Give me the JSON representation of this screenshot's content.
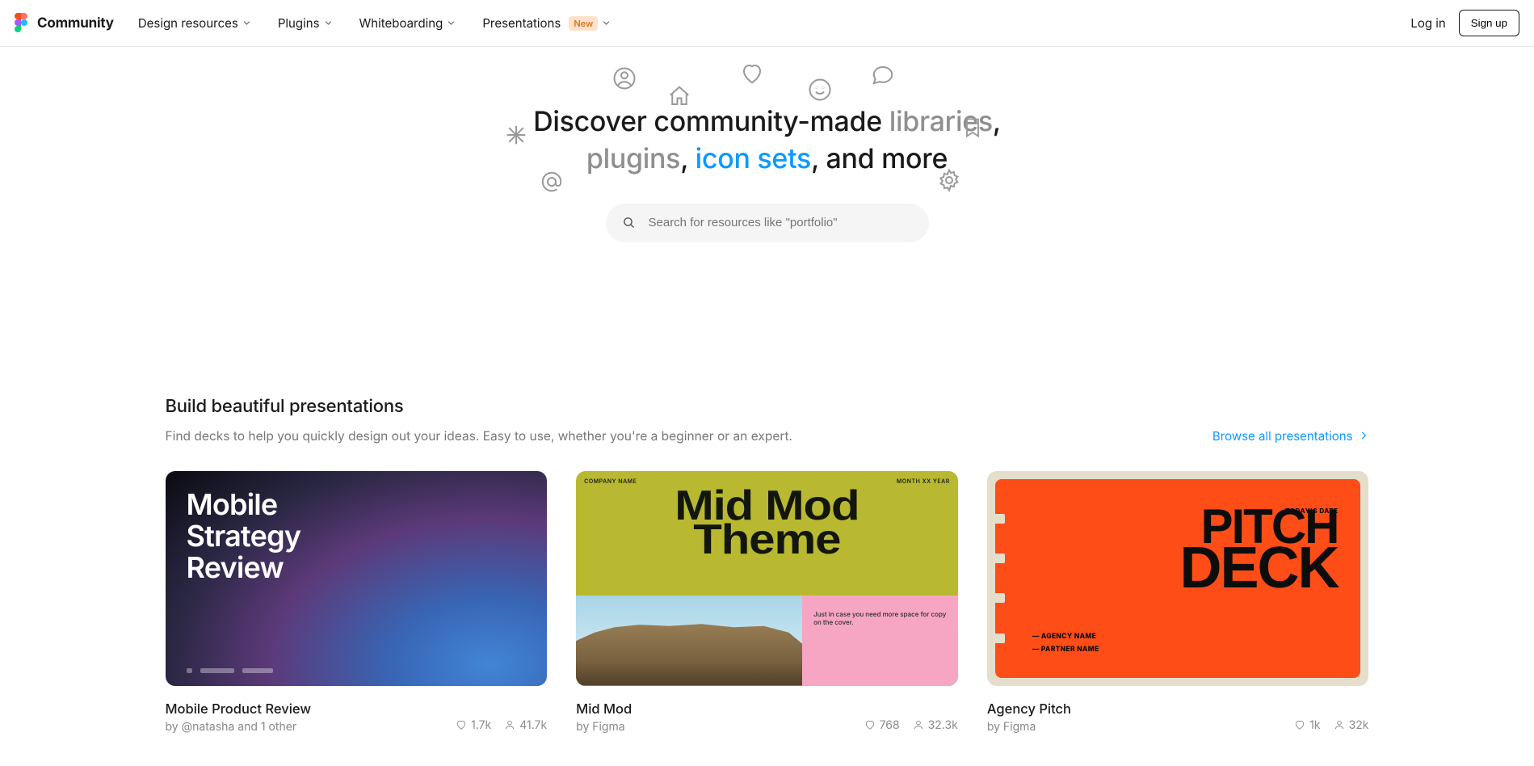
{
  "header": {
    "logo_text": "Community",
    "nav": {
      "design_resources": "Design resources",
      "plugins": "Plugins",
      "whiteboarding": "Whiteboarding",
      "presentations": "Presentations",
      "presentations_badge": "New"
    },
    "auth": {
      "login": "Log in",
      "signup": "Sign up"
    }
  },
  "hero": {
    "prefix": "Discover community-made ",
    "word1": "libraries",
    "sep1": ", ",
    "word2": "plugins",
    "sep2": ", ",
    "highlight": "icon sets",
    "suffix": ", and more",
    "search_placeholder": "Search for resources like \"portfolio\""
  },
  "section": {
    "title": "Build beautiful presentations",
    "subtitle": "Find decks to help you quickly design out your ideas. Easy to use, whether you're a beginner or an expert.",
    "browse": "Browse all presentations"
  },
  "cards": [
    {
      "thumb_text": "Mobile\nStrategy\nReview",
      "title": "Mobile Product Review",
      "author": "by @natasha and 1 other",
      "likes": "1.7k",
      "users": "41.7k"
    },
    {
      "thumb_text": "Mid Mod\nTheme",
      "thumb_meta": {
        "left": "COMPANY NAME",
        "right": "MONTH XX YEAR",
        "aside": "Just in case you need more space for copy on the cover."
      },
      "title": "Mid Mod",
      "author": "by Figma",
      "likes": "768",
      "users": "32.3k"
    },
    {
      "thumb_text": "PITCH\nDECK",
      "thumb_meta": {
        "date": "TODAY'S DATE",
        "agency": "AGENCY NAME",
        "partner": "PARTNER NAME"
      },
      "title": "Agency Pitch",
      "author": "by Figma",
      "likes": "1k",
      "users": "32k"
    }
  ]
}
